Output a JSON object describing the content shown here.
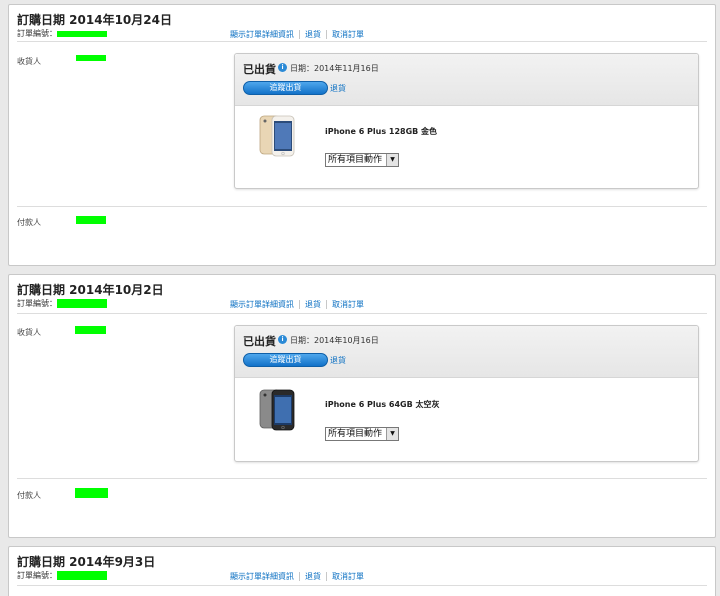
{
  "orders": [
    {
      "title": "訂購日期 2014年10月24日",
      "order_num_label": "訂單編號：",
      "links": [
        "顯示訂單詳細資訊",
        "退貨",
        "取消訂單"
      ],
      "recipient_label": "收貨人",
      "payer_label": "付款人",
      "shipment": {
        "status": "已出貨",
        "date": "日期：2014年11月16日",
        "track_label": "追蹤出貨",
        "return_label": "退貨",
        "product": "iPhone 6 Plus 128GB 金色",
        "action_select": "所有項目動作",
        "image": "iphone-6-plus-gold"
      }
    },
    {
      "title": "訂購日期 2014年10月2日",
      "order_num_label": "訂單編號：",
      "links": [
        "顯示訂單詳細資訊",
        "退貨",
        "取消訂單"
      ],
      "recipient_label": "收貨人",
      "payer_label": "付款人",
      "shipment": {
        "status": "已出貨",
        "date": "日期：2014年10月16日",
        "track_label": "追蹤出貨",
        "return_label": "退貨",
        "product": "iPhone 6 Plus 64GB 太空灰",
        "action_select": "所有項目動作",
        "image": "iphone-6-plus-space-gray"
      }
    },
    {
      "title": "訂購日期 2014年9月3日",
      "order_num_label": "訂單編號：",
      "links": [
        "顯示訂單詳細資訊",
        "退貨",
        "取消訂單"
      ]
    }
  ],
  "colors": {
    "link": "#0a6fc2",
    "redaction": "#00ff00",
    "button": "#1372c8"
  }
}
